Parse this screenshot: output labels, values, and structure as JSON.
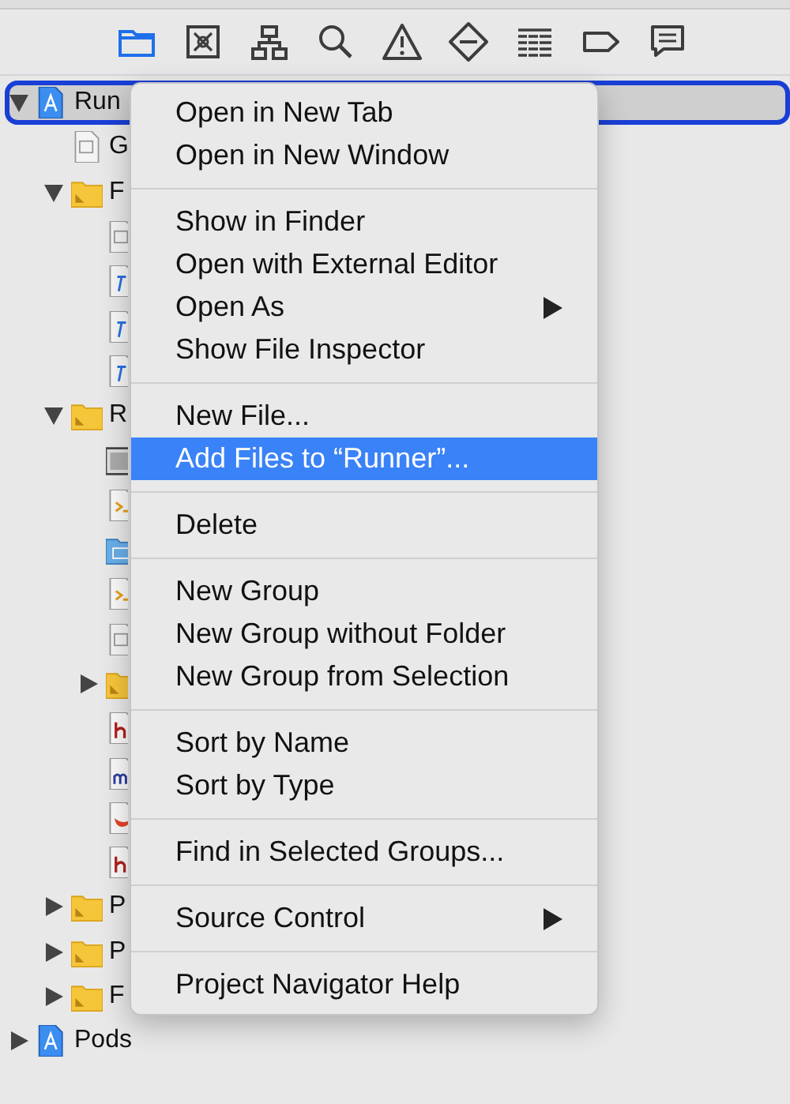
{
  "toolbar": [
    {
      "kind": "folder",
      "selected": true
    },
    {
      "kind": "source",
      "selected": false
    },
    {
      "kind": "hierarchy",
      "selected": false
    },
    {
      "kind": "search",
      "selected": false
    },
    {
      "kind": "warning",
      "selected": false
    },
    {
      "kind": "test",
      "selected": false
    },
    {
      "kind": "list",
      "selected": false
    },
    {
      "kind": "tag",
      "selected": false
    },
    {
      "kind": "comment",
      "selected": false
    }
  ],
  "navigator": [
    {
      "kind": "project",
      "label": "Run",
      "expanded": true,
      "selected": true,
      "children": [
        {
          "kind": "plist",
          "label": "G"
        },
        {
          "kind": "folder",
          "label": "F",
          "expanded": true,
          "children": [
            {
              "kind": "plist"
            },
            {
              "kind": "text"
            },
            {
              "kind": "text"
            },
            {
              "kind": "text"
            }
          ]
        },
        {
          "kind": "folder",
          "label": "R",
          "expanded": true,
          "children": [
            {
              "kind": "xib"
            },
            {
              "kind": "code"
            },
            {
              "kind": "assets"
            },
            {
              "kind": "code"
            },
            {
              "kind": "plist"
            },
            {
              "kind": "folder",
              "expanded": false
            },
            {
              "kind": "header"
            },
            {
              "kind": "source"
            },
            {
              "kind": "swift"
            },
            {
              "kind": "header"
            }
          ]
        },
        {
          "kind": "folder",
          "label": "P",
          "expanded": false
        },
        {
          "kind": "folder",
          "label": "P",
          "expanded": false
        },
        {
          "kind": "folder",
          "label": "F",
          "expanded": false
        }
      ]
    },
    {
      "kind": "project",
      "label": "Pods",
      "expanded": false,
      "selected": false
    }
  ],
  "context_menu": [
    [
      {
        "label": "Open in New Tab",
        "selected": false
      },
      {
        "label": "Open in New Window",
        "selected": false
      }
    ],
    [
      {
        "label": "Show in Finder",
        "selected": false
      },
      {
        "label": "Open with External Editor",
        "selected": false
      },
      {
        "label": "Open As",
        "selected": false,
        "submenu": true
      },
      {
        "label": "Show File Inspector",
        "selected": false
      }
    ],
    [
      {
        "label": "New File...",
        "selected": false
      },
      {
        "label": "Add Files to “Runner”...",
        "selected": true
      }
    ],
    [
      {
        "label": "Delete",
        "selected": false
      }
    ],
    [
      {
        "label": "New Group",
        "selected": false
      },
      {
        "label": "New Group without Folder",
        "selected": false
      },
      {
        "label": "New Group from Selection",
        "selected": false
      }
    ],
    [
      {
        "label": "Sort by Name",
        "selected": false
      },
      {
        "label": "Sort by Type",
        "selected": false
      }
    ],
    [
      {
        "label": "Find in Selected Groups...",
        "selected": false
      }
    ],
    [
      {
        "label": "Source Control",
        "selected": false,
        "submenu": true
      }
    ],
    [
      {
        "label": "Project Navigator Help",
        "selected": false
      }
    ]
  ]
}
